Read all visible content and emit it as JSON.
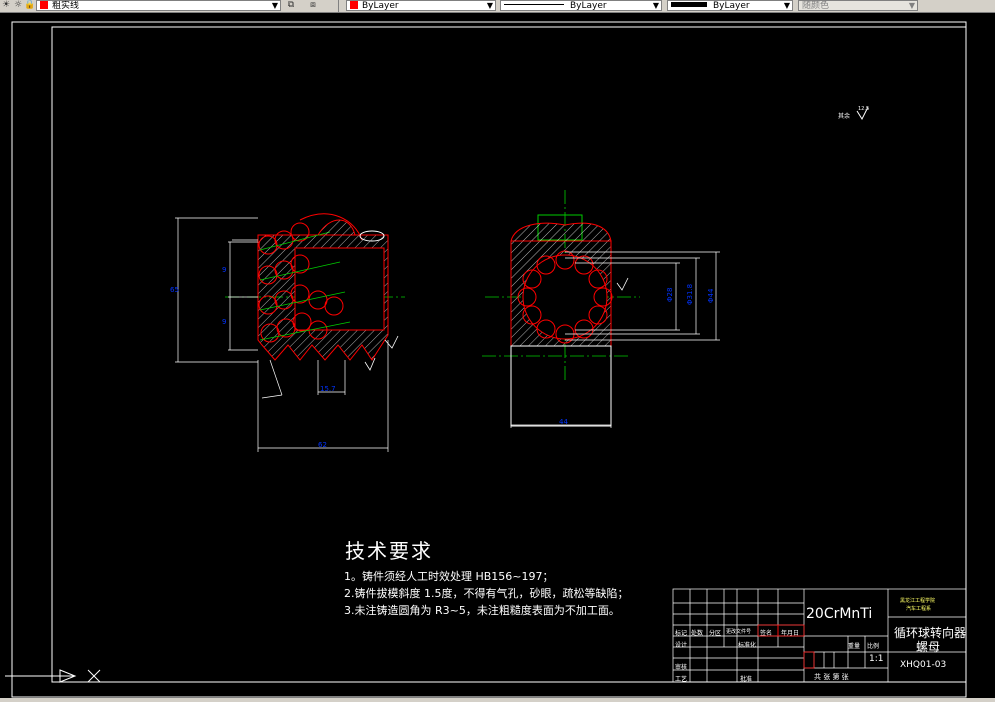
{
  "toolbar": {
    "layer_name": "粗实线",
    "color_label": "ByLayer",
    "linetype_label": "ByLayer",
    "lineweight_label": "ByLayer",
    "plotstyle_label": "随颜色",
    "colors": {
      "layer_swatch": "#ff0000",
      "color_swatch": "#ff0000",
      "lineweight_swatch": "#000000"
    }
  },
  "drawing": {
    "dims": {
      "height_left": "65",
      "pitch_a": "9",
      "pitch_b": "9",
      "width_bottom": "62",
      "groove": "15.7",
      "width_right": "44",
      "dia_a": "Φ28",
      "dia_b": "Φ31.8",
      "dia_c": "Φ44"
    },
    "roughness_label": "其余"
  },
  "tech_requirements": {
    "title": "技术要求",
    "lines": [
      "1。铸件须经人工时效处理  HB156~197；",
      "2.铸件拔模斜度 1.5度，不得有气孔，砂眼，疏松等缺陷；",
      "3.未注铸造圆角为  R3~5，未注粗糙度表面为不加工面。"
    ]
  },
  "title_block": {
    "material": "20CrMnTi",
    "school_line1": "黑龙江工程学院",
    "school_line2": "汽车工程系",
    "part_title_1": "循环球转向器",
    "part_title_2": "螺母",
    "drawing_no": "XHQ01-03",
    "scale": "1:1",
    "sheet_info": "共   张   第   张",
    "labels": {
      "mark": "标记",
      "count": "处数",
      "zone": "分区",
      "change_no": "更改文件号",
      "sign": "签名",
      "date": "年月日",
      "design": "设计",
      "standard": "标准化",
      "review": "审核",
      "process": "工艺",
      "approve": "批准",
      "stage": "阶段标记",
      "weight": "重量",
      "ratio": "比例"
    }
  }
}
